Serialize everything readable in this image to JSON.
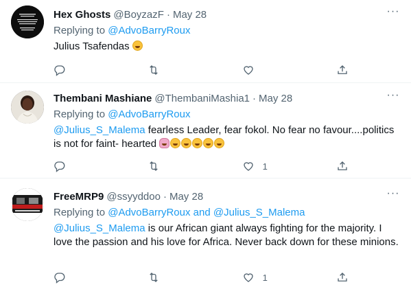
{
  "tweets": [
    {
      "name": "Hex Ghosts",
      "handle": "@BoyzazF",
      "date": "May 28",
      "replying_prefix": "Replying to ",
      "replying_to": [
        "@AdvoBarryRoux"
      ],
      "text": "Julius Tsafendas",
      "like_count": "",
      "emojis": [
        "rofl-emoji"
      ]
    },
    {
      "name": "Thembani Mashiane",
      "handle": "@ThembaniMashia1",
      "date": "May 28",
      "replying_prefix": "Replying to ",
      "replying_to": [
        "@AdvoBarryRoux"
      ],
      "mention": "@Julius_S_Malema",
      "text": " fearless Leader, fear fokol. No fear no favour....politics is not for faint- hearted",
      "like_count": "1",
      "emojis": [
        "woman-gesturing-emoji",
        "rofl-emoji",
        "rofl-emoji",
        "rofl-emoji",
        "rofl-emoji",
        "rofl-emoji"
      ]
    },
    {
      "name": "FreeMRP9",
      "handle": "@ssyyddoo",
      "date": "May 28",
      "replying_prefix": "Replying to ",
      "replying_to": [
        "@AdvoBarryRoux",
        "@Julius_S_Malema"
      ],
      "replying_joiner": " and ",
      "mention": "@Julius_S_Malema",
      "text": " is our African giant always fighting for the majority. I love the passion and his love for Africa. Never back down for these minions.",
      "like_count": "1"
    }
  ],
  "icons": {
    "reply": "reply-icon",
    "retweet": "retweet-icon",
    "like": "like-icon",
    "share": "share-icon",
    "more": "more-icon"
  },
  "colors": {
    "link": "#1d9bf0",
    "muted": "#536471",
    "text": "#0f1419"
  }
}
